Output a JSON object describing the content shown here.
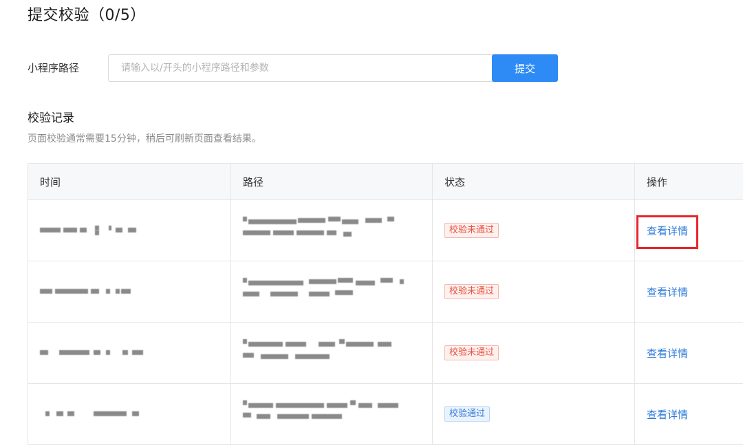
{
  "page": {
    "title": "提交校验（0/5）"
  },
  "form": {
    "label": "小程序路径",
    "input_placeholder": "请输入以/开头的小程序路径和参数",
    "input_value": "",
    "submit_label": "提交"
  },
  "records": {
    "title": "校验记录",
    "description": "页面校验通常需要15分钟，稍后可刷新页面查看结果。",
    "columns": [
      "时间",
      "路径",
      "状态",
      "操作"
    ],
    "rows": [
      {
        "time": "",
        "path": "",
        "status": "校验未通过",
        "status_type": "fail",
        "action": "查看详情",
        "highlighted": true
      },
      {
        "time": "",
        "path": "",
        "status": "校验未通过",
        "status_type": "fail",
        "action": "查看详情",
        "highlighted": false
      },
      {
        "time": "",
        "path": "",
        "status": "校验未通过",
        "status_type": "fail",
        "action": "查看详情",
        "highlighted": false
      },
      {
        "time": "",
        "path": "",
        "status": "校验通过",
        "status_type": "pass",
        "action": "查看详情",
        "highlighted": false
      }
    ]
  },
  "colors": {
    "primary": "#2e8bf5",
    "link": "#2e7ad9",
    "fail": "#e8533f",
    "pass": "#3a7ed8",
    "highlight": "#e8242a"
  }
}
